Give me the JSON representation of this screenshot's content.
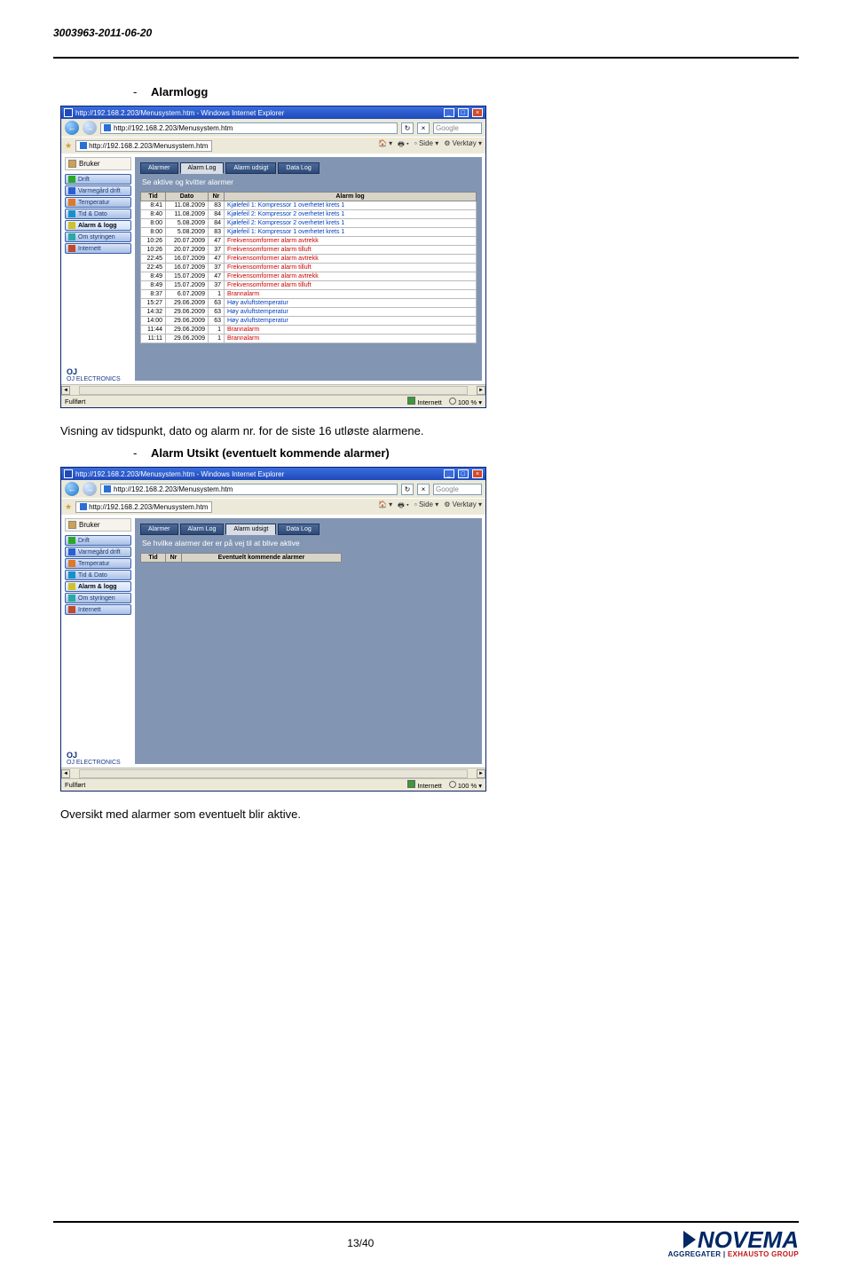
{
  "doc_id": "3003963-2011-06-20",
  "sections": {
    "alarmlogg_heading": "Alarmlogg",
    "alarm_utsikt_heading": "Alarm Utsikt (eventuelt kommende alarmer)"
  },
  "body_text": {
    "line1": "Visning av tidspunkt, dato og alarm nr. for de siste 16 utløste alarmene.",
    "line2": "Oversikt med alarmer som eventuelt blir aktive."
  },
  "browser": {
    "title": "http://192.168.2.203/Menusystem.htm - Windows Internet Explorer",
    "url": "http://192.168.2.203/Menusystem.htm",
    "tab_label": "http://192.168.2.203/Menusystem.htm",
    "search_placeholder": "Google",
    "toolbar_side": "Side",
    "toolbar_tools": "Verktøy",
    "user_label": "Bruker",
    "status_left": "Fullført",
    "status_zone": "Internett",
    "status_zoom": "100 %",
    "oj_brand": "OJ ELECTRONICS"
  },
  "sidebar_items": [
    {
      "label": "Drift",
      "icon_color": "#2aa82a"
    },
    {
      "label": "Varmegård drift",
      "icon_color": "#2a60d0"
    },
    {
      "label": "Temperatur",
      "icon_color": "#e07828"
    },
    {
      "label": "Tid & Dato",
      "icon_color": "#1890c8"
    },
    {
      "label": "Alarm & logg",
      "icon_color": "#d0c030",
      "active": true
    },
    {
      "label": "Om styringen",
      "icon_color": "#2aa8a8"
    },
    {
      "label": "Internett",
      "icon_color": "#c04a2a"
    }
  ],
  "screenshot1": {
    "tabs": [
      "Alarmer",
      "Alarm Log",
      "Alarm udsigt",
      "Data Log"
    ],
    "active_tab": "Alarm Log",
    "subtitle": "Se aktive og kvitter alarmer",
    "columns": [
      "Tid",
      "Dato",
      "Nr",
      "Alarm log"
    ],
    "rows": [
      {
        "tid": "8:41",
        "dato": "11.08.2009",
        "nr": "83",
        "msg": "Kjølefeil 1: Kompressor 1 overhetet krets 1",
        "c": "blue"
      },
      {
        "tid": "8:40",
        "dato": "11.08.2009",
        "nr": "84",
        "msg": "Kjølefeil 2: Kompressor 2 overhetet krets 1",
        "c": "blue"
      },
      {
        "tid": "8:00",
        "dato": "5.08.2009",
        "nr": "84",
        "msg": "Kjølefeil 2: Kompressor 2 overhetet krets 1",
        "c": "blue"
      },
      {
        "tid": "8:00",
        "dato": "5.08.2009",
        "nr": "83",
        "msg": "Kjølefeil 1: Kompressor 1 overhetet krets 1",
        "c": "blue"
      },
      {
        "tid": "10:26",
        "dato": "20.07.2009",
        "nr": "47",
        "msg": "Frekvensomformer alarm avtrekk",
        "c": "red"
      },
      {
        "tid": "10:26",
        "dato": "20.07.2009",
        "nr": "37",
        "msg": "Frekvensomformer alarm tilluft",
        "c": "red"
      },
      {
        "tid": "22:45",
        "dato": "16.07.2009",
        "nr": "47",
        "msg": "Frekvensomformer alarm avtrekk",
        "c": "red"
      },
      {
        "tid": "22:45",
        "dato": "16.07.2009",
        "nr": "37",
        "msg": "Frekvensomformer alarm tilluft",
        "c": "red"
      },
      {
        "tid": "8:49",
        "dato": "15.07.2009",
        "nr": "47",
        "msg": "Frekvensomformer alarm avtrekk",
        "c": "red"
      },
      {
        "tid": "8:49",
        "dato": "15.07.2009",
        "nr": "37",
        "msg": "Frekvensomformer alarm tilluft",
        "c": "red"
      },
      {
        "tid": "8:37",
        "dato": "6.07.2009",
        "nr": "1",
        "msg": "Brannalarm",
        "c": "red"
      },
      {
        "tid": "15:27",
        "dato": "29.06.2009",
        "nr": "63",
        "msg": "Høy avluftstemperatur",
        "c": "blue"
      },
      {
        "tid": "14:32",
        "dato": "29.06.2009",
        "nr": "63",
        "msg": "Høy avluftstemperatur",
        "c": "blue"
      },
      {
        "tid": "14:00",
        "dato": "29.06.2009",
        "nr": "63",
        "msg": "Høy avluftstemperatur",
        "c": "blue"
      },
      {
        "tid": "11:44",
        "dato": "29.06.2009",
        "nr": "1",
        "msg": "Brannalarm",
        "c": "red"
      },
      {
        "tid": "11:11",
        "dato": "29.06.2009",
        "nr": "1",
        "msg": "Brannalarm",
        "c": "red"
      }
    ]
  },
  "screenshot2": {
    "tabs": [
      "Alarmer",
      "Alarm Log",
      "Alarm udsigt",
      "Data Log"
    ],
    "active_tab": "Alarm udsigt",
    "subtitle": "Se hvilke alarmer der er på vej til at blive aktive",
    "columns": [
      "Tid",
      "Nr",
      "Eventuelt kommende alarmer"
    ]
  },
  "footer": {
    "page": "13/40",
    "brand": "NOVEMA",
    "brand_sub1": "AGGREGATER",
    "brand_sub_sep": " | ",
    "brand_sub2": "EXHAUSTO GROUP"
  }
}
